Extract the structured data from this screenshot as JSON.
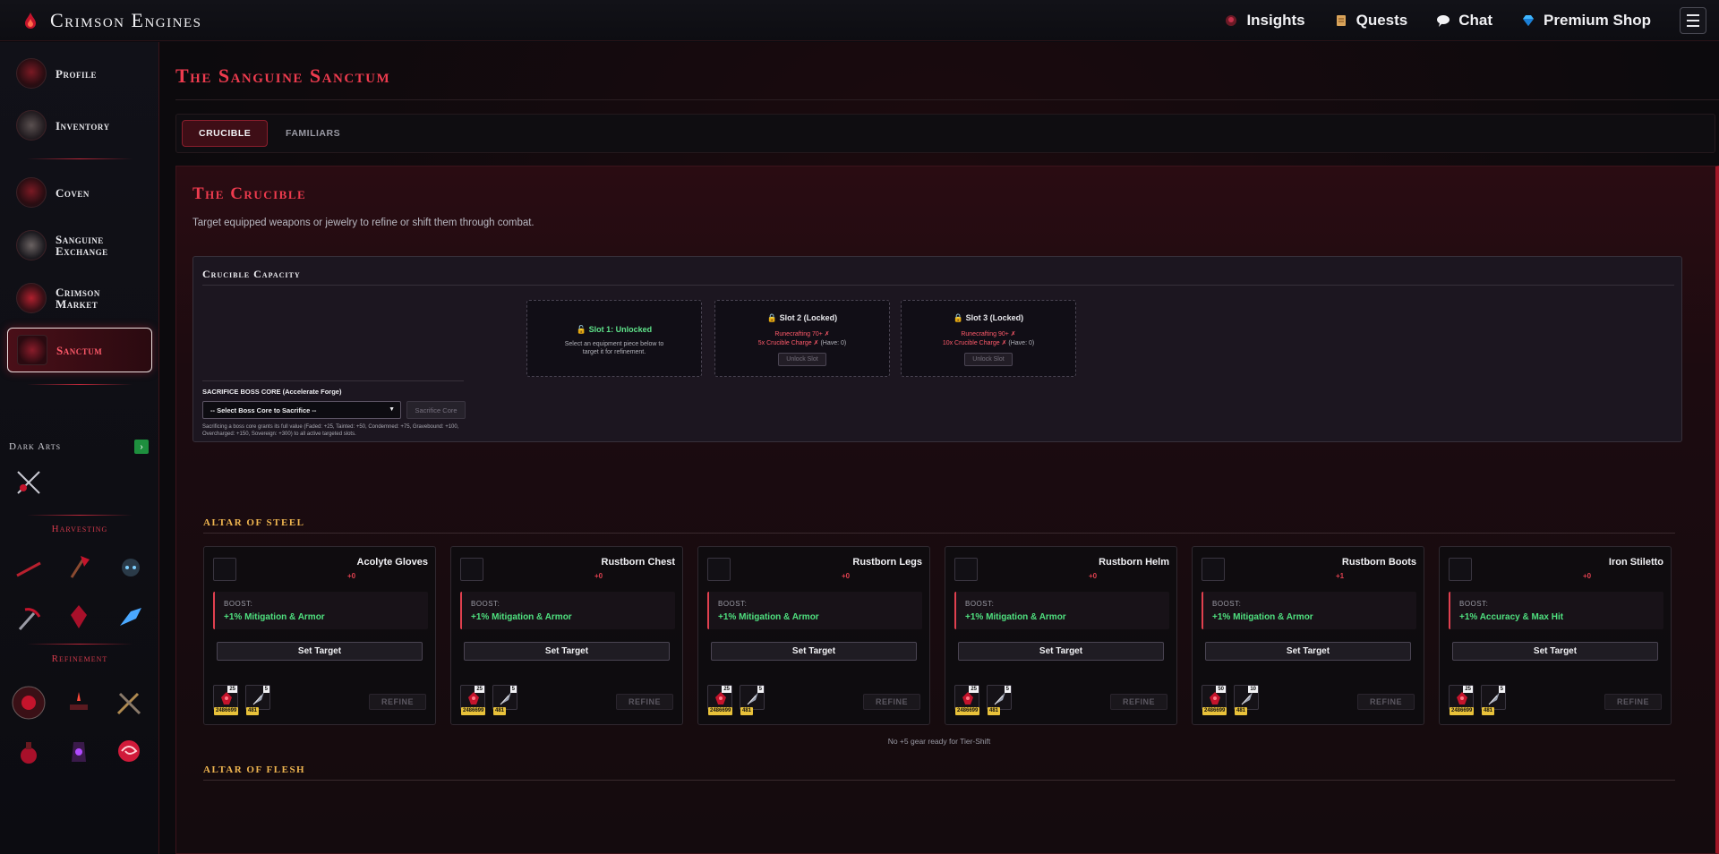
{
  "app": {
    "name": "Crimson Engines",
    "accent": "#ee3b4e",
    "gold": "#f0b650",
    "green": "#4fe07f"
  },
  "topnav": [
    {
      "label": "Insights",
      "icon": "orb-icon"
    },
    {
      "label": "Quests",
      "icon": "scroll-icon"
    },
    {
      "label": "Chat",
      "icon": "chat-bubble-icon"
    },
    {
      "label": "Premium Shop",
      "icon": "diamond-icon"
    }
  ],
  "sidebar": {
    "items": [
      {
        "label": "Profile",
        "icon": "profile-sigil-icon"
      },
      {
        "label": "Inventory",
        "icon": "inventory-sigil-icon"
      },
      {
        "label": "Coven",
        "icon": "coven-sigil-icon"
      },
      {
        "label": "Sanguine Exchange",
        "icon": "scales-icon"
      },
      {
        "label": "Crimson Market",
        "icon": "market-icon"
      },
      {
        "label": "Sanctum",
        "icon": "sanctum-icon"
      }
    ],
    "dark_arts_label": "Dark Arts",
    "dark_arts_button": "›",
    "harvesting_label": "Harvesting",
    "refinement_label": "Refinement"
  },
  "page": {
    "title": "The Sanguine Sanctum",
    "tabs": [
      "CRUCIBLE",
      "FAMILIARS"
    ]
  },
  "crucible": {
    "title": "The Crucible",
    "subtitle": "Target equipped weapons or jewelry to refine or shift them through combat.",
    "capacity_title": "Crucible Capacity",
    "slots": [
      {
        "title": "Slot 1: Unlocked",
        "desc": "Select an equipment piece below to target it for refinement."
      },
      {
        "title": "Slot 2 (Locked)",
        "req1": "Runecrafting 70+ ✗",
        "req2": "5x Crucible Charge ✗",
        "have": "(Have: 0)",
        "button": "Unlock Slot"
      },
      {
        "title": "Slot 3 (Locked)",
        "req1": "Runecrafting 90+ ✗",
        "req2": "10x Crucible Charge ✗",
        "have": "(Have: 0)",
        "button": "Unlock Slot"
      }
    ],
    "sacrifice": {
      "title": "SACRIFICE BOSS CORE (Accelerate Forge)",
      "select": "-- Select Boss Core to Sacrifice --",
      "button": "Sacrifice Core",
      "note": "Sacrificing a boss core grants its full value (Faded: +25, Tainted: +50, Condemned: +75, Gravebound: +100, Overcharged: +150, Sovereign: +300) to all active targeted slots."
    }
  },
  "altar_steel": {
    "title": "ALTAR OF STEEL",
    "set_label": "Set Target",
    "boost_label": "BOOST:",
    "refine_label": "REFINE",
    "items": [
      {
        "name": "Acolyte Gloves",
        "level": "+0",
        "boost": "+1% Mitigation & Armor",
        "mat1_qty": "25",
        "mat1_stock": "2486699",
        "mat2_qty": "5",
        "mat2_stock": "481",
        "icon": "gloves-icon"
      },
      {
        "name": "Rustborn Chest",
        "level": "+0",
        "boost": "+1% Mitigation & Armor",
        "mat1_qty": "25",
        "mat1_stock": "2486699",
        "mat2_qty": "5",
        "mat2_stock": "481",
        "icon": "chest-armor-icon"
      },
      {
        "name": "Rustborn Legs",
        "level": "+0",
        "boost": "+1% Mitigation & Armor",
        "mat1_qty": "25",
        "mat1_stock": "2486699",
        "mat2_qty": "5",
        "mat2_stock": "481",
        "icon": "leg-armor-icon"
      },
      {
        "name": "Rustborn Helm",
        "level": "+0",
        "boost": "+1% Mitigation & Armor",
        "mat1_qty": "25",
        "mat1_stock": "2486699",
        "mat2_qty": "5",
        "mat2_stock": "481",
        "icon": "helm-icon"
      },
      {
        "name": "Rustborn Boots",
        "level": "+1",
        "boost": "+1% Mitigation & Armor",
        "mat1_qty": "50",
        "mat1_stock": "2486699",
        "mat2_qty": "10",
        "mat2_stock": "481",
        "icon": "boots-icon"
      },
      {
        "name": "Iron Stiletto",
        "level": "+0",
        "boost": "+1% Accuracy & Max Hit",
        "mat1_qty": "25",
        "mat1_stock": "2486699",
        "mat2_qty": "5",
        "mat2_stock": "481",
        "icon": "dagger-icon"
      }
    ]
  },
  "altar_flesh": {
    "title": "ALTAR OF FLESH",
    "empty": "No +5 gear ready for Tier-Shift"
  }
}
